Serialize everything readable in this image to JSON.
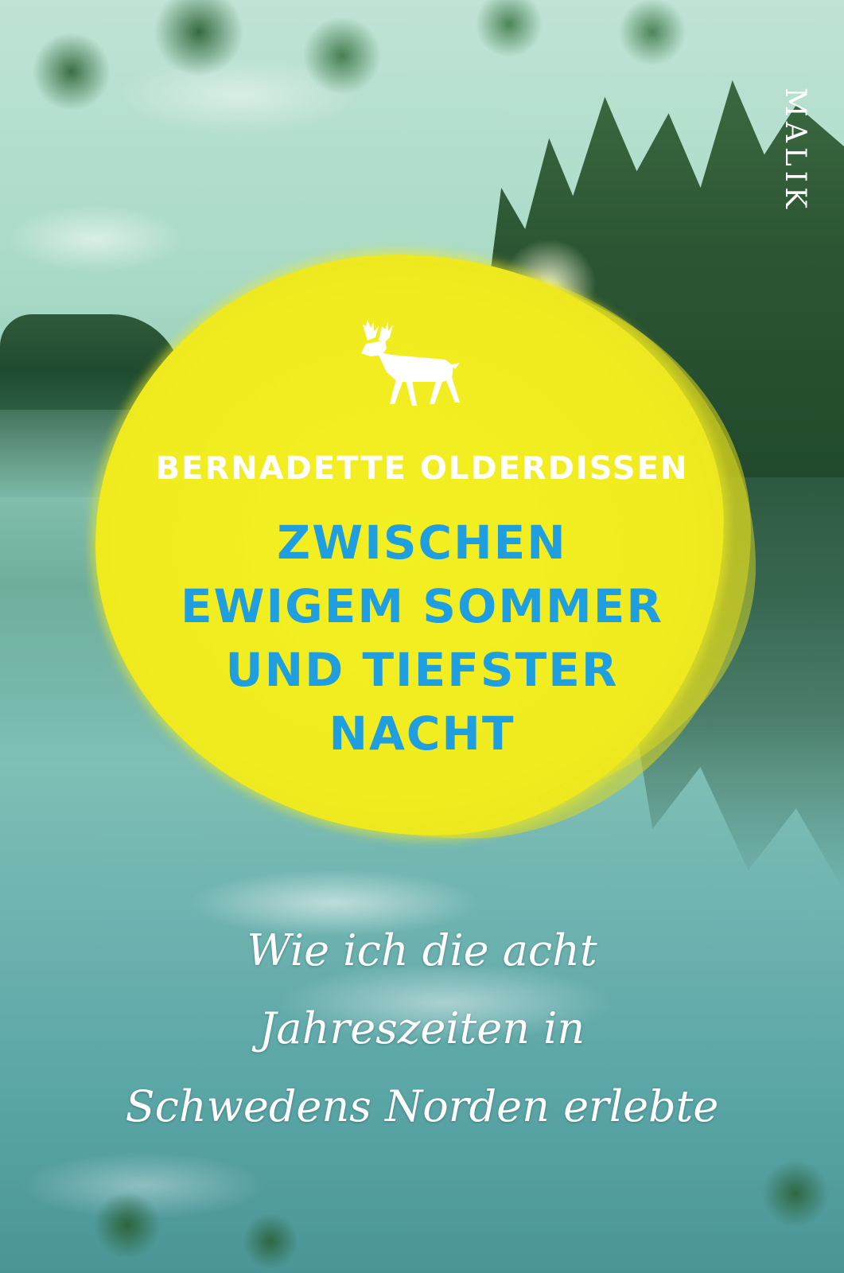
{
  "cover": {
    "author": "BERNADETTE OLDERDISSEN",
    "title_lines": [
      "ZWISCHEN",
      "EWIGEM SOMMER",
      "UND TIEFSTER",
      "NACHT"
    ],
    "subtitle_lines": [
      "Wie ich die acht",
      "Jahreszeiten in",
      "Schwedens Norden erlebte"
    ],
    "publisher": "MALIK",
    "logo_icon": "reindeer-icon"
  },
  "colors": {
    "title": "#1f9ee0",
    "blob": "#f1ec1f",
    "text_light": "#ffffff"
  }
}
